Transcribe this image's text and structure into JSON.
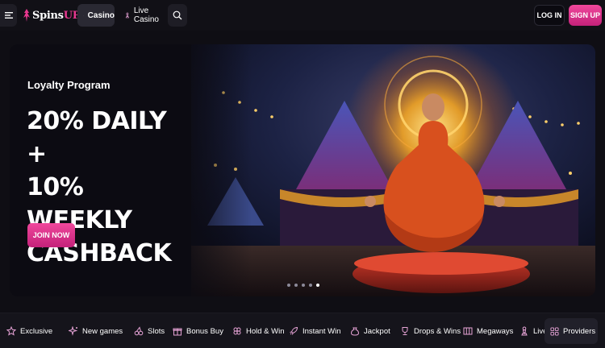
{
  "header": {
    "logo_text": "Spins",
    "logo_accent": "UP!",
    "nav": [
      {
        "label": "Casino",
        "icon": "spade-icon",
        "active": true
      },
      {
        "label": "Live Casino",
        "icon": "chess-pawn-icon",
        "active": false
      }
    ],
    "login_label": "LOG IN",
    "signup_label": "SIGN UP"
  },
  "hero": {
    "kicker": "Loyalty Program",
    "title_lines": [
      "20% DAILY +",
      "10% WEEKLY",
      "CASHBACK"
    ],
    "cta_label": "JOIN NOW",
    "slide_count": 5,
    "active_slide": 5
  },
  "categories": [
    {
      "label": "Exclusive",
      "icon": "star-icon"
    },
    {
      "label": "New games",
      "icon": "sparkle-icon"
    },
    {
      "label": "Slots",
      "icon": "cherries-icon"
    },
    {
      "label": "Bonus Buy",
      "icon": "gift-icon"
    },
    {
      "label": "Hold & Win",
      "icon": "clover-icon"
    },
    {
      "label": "Instant Win",
      "icon": "rocket-icon"
    },
    {
      "label": "Jackpot",
      "icon": "money-bag-icon"
    },
    {
      "label": "Drops & Wins",
      "icon": "trophy-icon"
    },
    {
      "label": "Megaways",
      "icon": "slot-reels-icon"
    },
    {
      "label": "Live Casino",
      "icon": "chess-pawn-icon"
    }
  ],
  "providers_label": "Providers",
  "colors": {
    "accent": "#e8378f",
    "background": "#0f0e14",
    "icon": "#e6a3d6"
  }
}
